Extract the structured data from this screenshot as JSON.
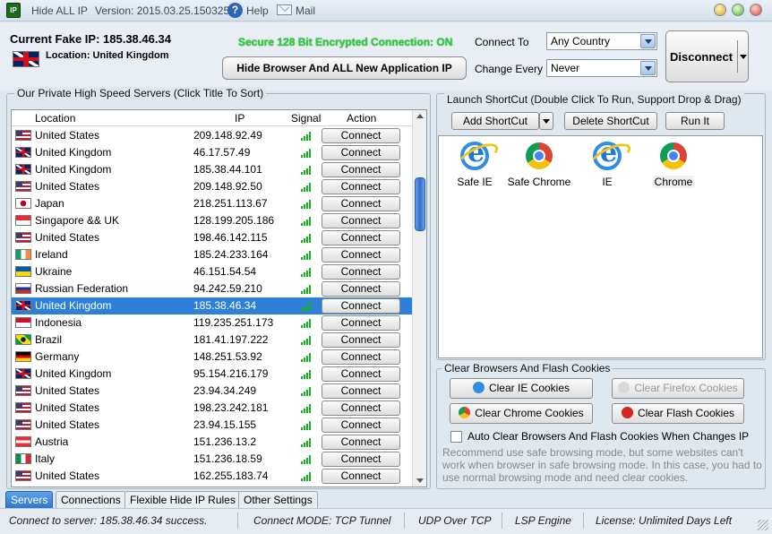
{
  "titlebar": {
    "app_name": "Hide ALL IP",
    "version": "Version: 2015.03.25.150325",
    "help": "Help",
    "mail": "Mail",
    "logo": "IP"
  },
  "status_top": {
    "current_ip": "Current Fake IP: 185.38.46.34",
    "location": "Location: United Kingdom",
    "secure_text": "Secure 128 Bit Encrypted Connection: ON",
    "hide_button": "Hide Browser And ALL New Application IP",
    "connect_to_label": "Connect To",
    "connect_to_value": "Any Country",
    "change_every_label": "Change Every",
    "change_every_value": "Never",
    "disconnect_button": "Disconnect"
  },
  "servers": {
    "panel_title": "Our Private High Speed Servers (Click Title To Sort)",
    "columns": [
      "Location",
      "IP",
      "Signal",
      "Action"
    ],
    "connect_label": "Connect",
    "rows": [
      {
        "flag": "us",
        "location": "United States",
        "ip": "209.148.92.49"
      },
      {
        "flag": "uk",
        "location": "United Kingdom",
        "ip": "46.17.57.49"
      },
      {
        "flag": "uk",
        "location": "United Kingdom",
        "ip": "185.38.44.101"
      },
      {
        "flag": "us",
        "location": "United States",
        "ip": "209.148.92.50"
      },
      {
        "flag": "jp",
        "location": "Japan",
        "ip": "218.251.113.67"
      },
      {
        "flag": "sg",
        "location": "Singapore && UK",
        "ip": "128.199.205.186"
      },
      {
        "flag": "us",
        "location": "United States",
        "ip": "198.46.142.115"
      },
      {
        "flag": "ie",
        "location": "Ireland",
        "ip": "185.24.233.164"
      },
      {
        "flag": "ua",
        "location": "Ukraine",
        "ip": "46.151.54.54"
      },
      {
        "flag": "ru",
        "location": "Russian Federation",
        "ip": "94.242.59.210"
      },
      {
        "flag": "uk",
        "location": "United Kingdom",
        "ip": "185.38.46.34",
        "selected": true
      },
      {
        "flag": "id",
        "location": "Indonesia",
        "ip": "119.235.251.173"
      },
      {
        "flag": "br",
        "location": "Brazil",
        "ip": "181.41.197.222"
      },
      {
        "flag": "de",
        "location": "Germany",
        "ip": "148.251.53.92"
      },
      {
        "flag": "uk",
        "location": "United Kingdom",
        "ip": "95.154.216.179"
      },
      {
        "flag": "us",
        "location": "United States",
        "ip": "23.94.34.249"
      },
      {
        "flag": "us",
        "location": "United States",
        "ip": "198.23.242.181"
      },
      {
        "flag": "us",
        "location": "United States",
        "ip": "23.94.15.155"
      },
      {
        "flag": "at",
        "location": "Austria",
        "ip": "151.236.13.2"
      },
      {
        "flag": "it",
        "location": "Italy",
        "ip": "151.236.18.59"
      },
      {
        "flag": "us",
        "location": "United States",
        "ip": "162.255.183.74"
      }
    ]
  },
  "shortcuts": {
    "panel_title": "Launch ShortCut (Double Click To Run, Support Drop & Drag)",
    "add_button": "Add ShortCut",
    "delete_button": "Delete ShortCut",
    "run_button": "Run It",
    "items": [
      {
        "icon": "ie-icon",
        "label": "Safe IE"
      },
      {
        "icon": "chrome-icon",
        "label": "Safe Chrome"
      },
      {
        "icon": "ie-icon",
        "label": "IE"
      },
      {
        "icon": "chrome-icon",
        "label": "Chrome"
      }
    ]
  },
  "cookies": {
    "panel_title": "Clear Browsers And Flash Cookies",
    "clear_ie": "Clear IE Cookies",
    "clear_firefox": "Clear Firefox Cookies",
    "clear_chrome": "Clear Chrome Cookies",
    "clear_flash": "Clear Flash Cookies",
    "auto_clear": "Auto Clear Browsers And Flash Cookies When Changes IP",
    "note": "Recommend use safe browsing mode, but some websites can't work when browser in safe browsing mode. In this case, you had to use normal browsing mode and need clear cookies."
  },
  "tabs": [
    "Servers",
    "Connections",
    "Flexible Hide IP Rules",
    "Other Settings"
  ],
  "statusbar": {
    "connect": "Connect to server: 185.38.46.34 success.",
    "mode": "Connect MODE: TCP Tunnel",
    "udp": "UDP Over TCP",
    "lsp": "LSP Engine",
    "license": "License: Unlimited Days Left"
  }
}
